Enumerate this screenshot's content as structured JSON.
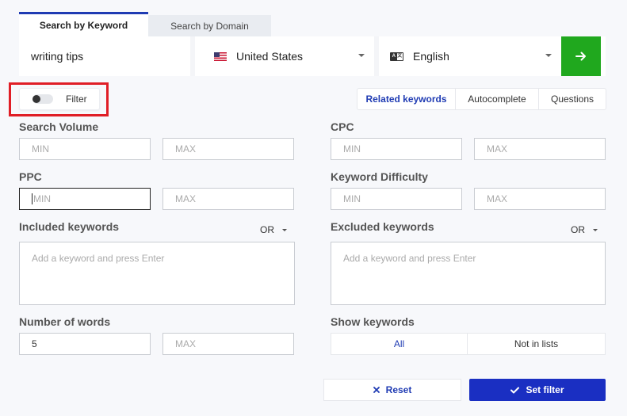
{
  "tabs": {
    "keyword": "Search by Keyword",
    "domain": "Search by Domain"
  },
  "search": {
    "query": "writing tips",
    "country": "United States",
    "language": "English",
    "lang_badge_left": "A",
    "lang_badge_right": "文"
  },
  "filter": {
    "label": "Filter",
    "enabled": false
  },
  "modes": {
    "related": "Related keywords",
    "autocomplete": "Autocomplete",
    "questions": "Questions"
  },
  "filters": {
    "search_volume": {
      "label": "Search Volume",
      "min": "MIN",
      "max": "MAX"
    },
    "cpc": {
      "label": "CPC",
      "min": "MIN",
      "max": "MAX"
    },
    "ppc": {
      "label": "PPC",
      "min": "MIN",
      "max": "MAX"
    },
    "kd": {
      "label": "Keyword Difficulty",
      "min": "MIN",
      "max": "MAX"
    },
    "included": {
      "label": "Included keywords",
      "operator": "OR",
      "placeholder": "Add a keyword and press Enter"
    },
    "excluded": {
      "label": "Excluded keywords",
      "operator": "OR",
      "placeholder": "Add a keyword and press Enter"
    },
    "words": {
      "label": "Number of words",
      "min_value": "5",
      "max": "MAX"
    },
    "show": {
      "label": "Show keywords",
      "all": "All",
      "not_in_lists": "Not in lists"
    }
  },
  "actions": {
    "reset": "Reset",
    "set": "Set filter"
  },
  "colors": {
    "accent": "#1f3bb3",
    "go": "#20a81e",
    "highlight": "#e01e26"
  }
}
